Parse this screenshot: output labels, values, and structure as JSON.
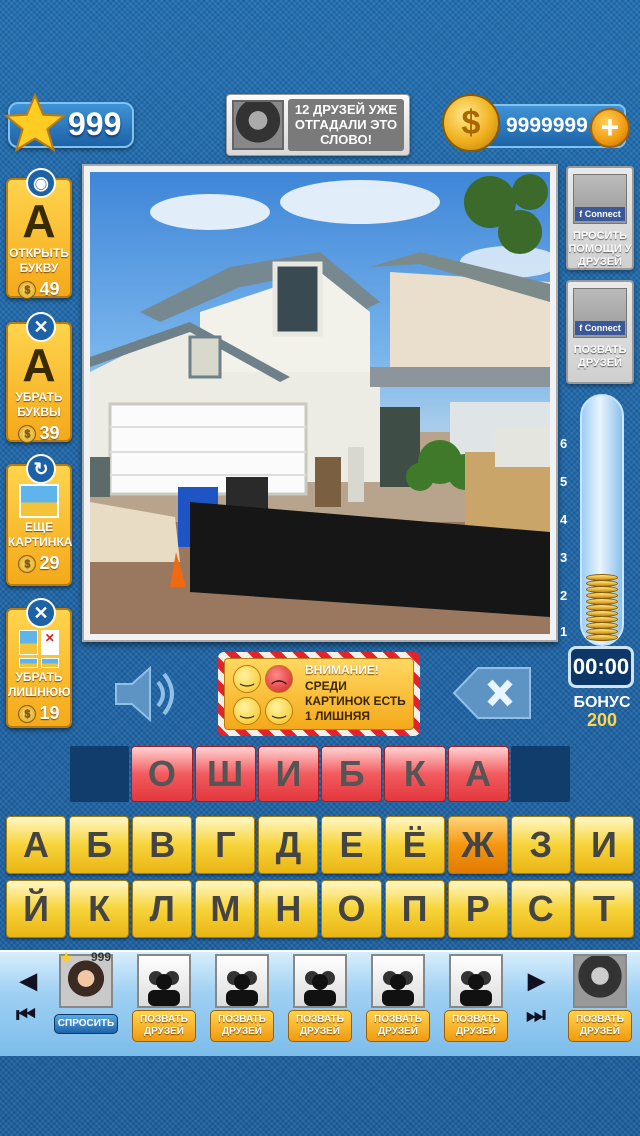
{
  "header": {
    "stars": "999",
    "friends_guessed": "12 ДРУЗЕЙ УЖЕ ОТГАДАЛИ ЭТО СЛОВО!",
    "coins": "9999999",
    "coin_symbol": "$",
    "plus": "+"
  },
  "hints": [
    {
      "icon": "eye-icon",
      "glyph": "A",
      "label": "ОТКРЫТЬ БУКВУ",
      "cost": "49"
    },
    {
      "icon": "close-icon",
      "glyph": "A",
      "label": "УБРАТЬ БУКВЫ",
      "cost": "39"
    },
    {
      "icon": "refresh-icon",
      "glyph": "",
      "label": "ЕЩЕ КАРТИНКА",
      "cost": "29"
    },
    {
      "icon": "close-icon",
      "glyph": "",
      "label": "УБРАТЬ ЛИШНЮЮ",
      "cost": "19"
    }
  ],
  "right_panel": {
    "fb_connect": "f Connect",
    "ask_friends": "ПРОСИТЬ ПОМОЩИ У ДРУЗЕЙ",
    "invite_friends": "ПОЗВАТЬ ДРУЗЕЙ",
    "scale": [
      "6",
      "5",
      "4",
      "3",
      "2",
      "1"
    ],
    "timer": "00:00",
    "bonus_label": "БОНУС",
    "bonus_value": "200"
  },
  "warning": {
    "title": "ВНИМАНИЕ!",
    "text": "СРЕДИ КАРТИНОК ЕСТЬ 1 ЛИШНЯЯ"
  },
  "answer": [
    "О",
    "Ш",
    "И",
    "Б",
    "К",
    "А"
  ],
  "keyboard": {
    "row1": [
      "А",
      "Б",
      "В",
      "Г",
      "Д",
      "Е",
      "Ё",
      "Ж",
      "З",
      "И"
    ],
    "row2": [
      "Й",
      "К",
      "Л",
      "М",
      "Н",
      "О",
      "П",
      "Р",
      "С",
      "Т"
    ],
    "highlighted_key": "Ж"
  },
  "bottom": {
    "me_stars": "999",
    "ask_label": "СПРОСИТЬ",
    "invite_label": "ПОЗВАТЬ ДРУЗЕЙ"
  }
}
